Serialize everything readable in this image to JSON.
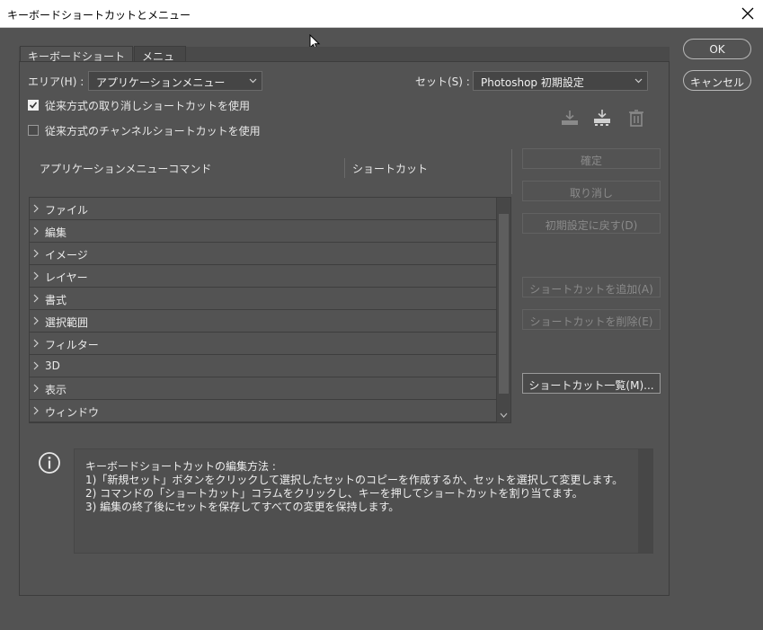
{
  "window": {
    "title": "キーボードショートカットとメニュー"
  },
  "tabs": [
    {
      "label": "キーボードショートカット"
    },
    {
      "label": "メニュー"
    }
  ],
  "area": {
    "label": "エリア(H) :",
    "value": "アプリケーションメニュー"
  },
  "set": {
    "label": "セット(S) :",
    "value": "Photoshop 初期設定"
  },
  "options": {
    "legacy_undo": {
      "label": "従来方式の取り消しショートカットを使用",
      "checked": true
    },
    "legacy_channel": {
      "label": "従来方式のチャンネルショートカットを使用",
      "checked": false
    }
  },
  "set_icons": [
    "save-set-icon",
    "new-set-icon",
    "delete-set-icon"
  ],
  "table": {
    "headers": [
      "アプリケーションメニューコマンド",
      "ショートカット"
    ],
    "rows": [
      "ファイル",
      "編集",
      "イメージ",
      "レイヤー",
      "書式",
      "選択範囲",
      "フィルター",
      "3D",
      "表示",
      "ウィンドウ"
    ]
  },
  "side_buttons": {
    "accept": "確定",
    "undo": "取り消し",
    "use_default": "初期設定に戻す(D)",
    "add_shortcut": "ショートカットを追加(A)",
    "delete_shortcut": "ショートカットを削除(E)",
    "summarize": "ショートカット一覧(M)..."
  },
  "dialog_buttons": {
    "ok": "OK",
    "cancel": "キャンセル"
  },
  "info": {
    "lines": [
      "キーボードショートカットの編集方法 :",
      "1)「新規セット」ボタンをクリックして選択したセットのコピーを作成するか、セットを選択して変更します。",
      "2) コマンドの「ショートカット」コラムをクリックし、キーを押してショートカットを割り当てます。",
      "3) 編集の終了後にセットを保存してすべての変更を保持します。"
    ]
  },
  "colors": {
    "background": "#535353",
    "titlebar": "#ffffff",
    "text": "#e8e8e8",
    "disabled_text": "#8a8a8a"
  }
}
